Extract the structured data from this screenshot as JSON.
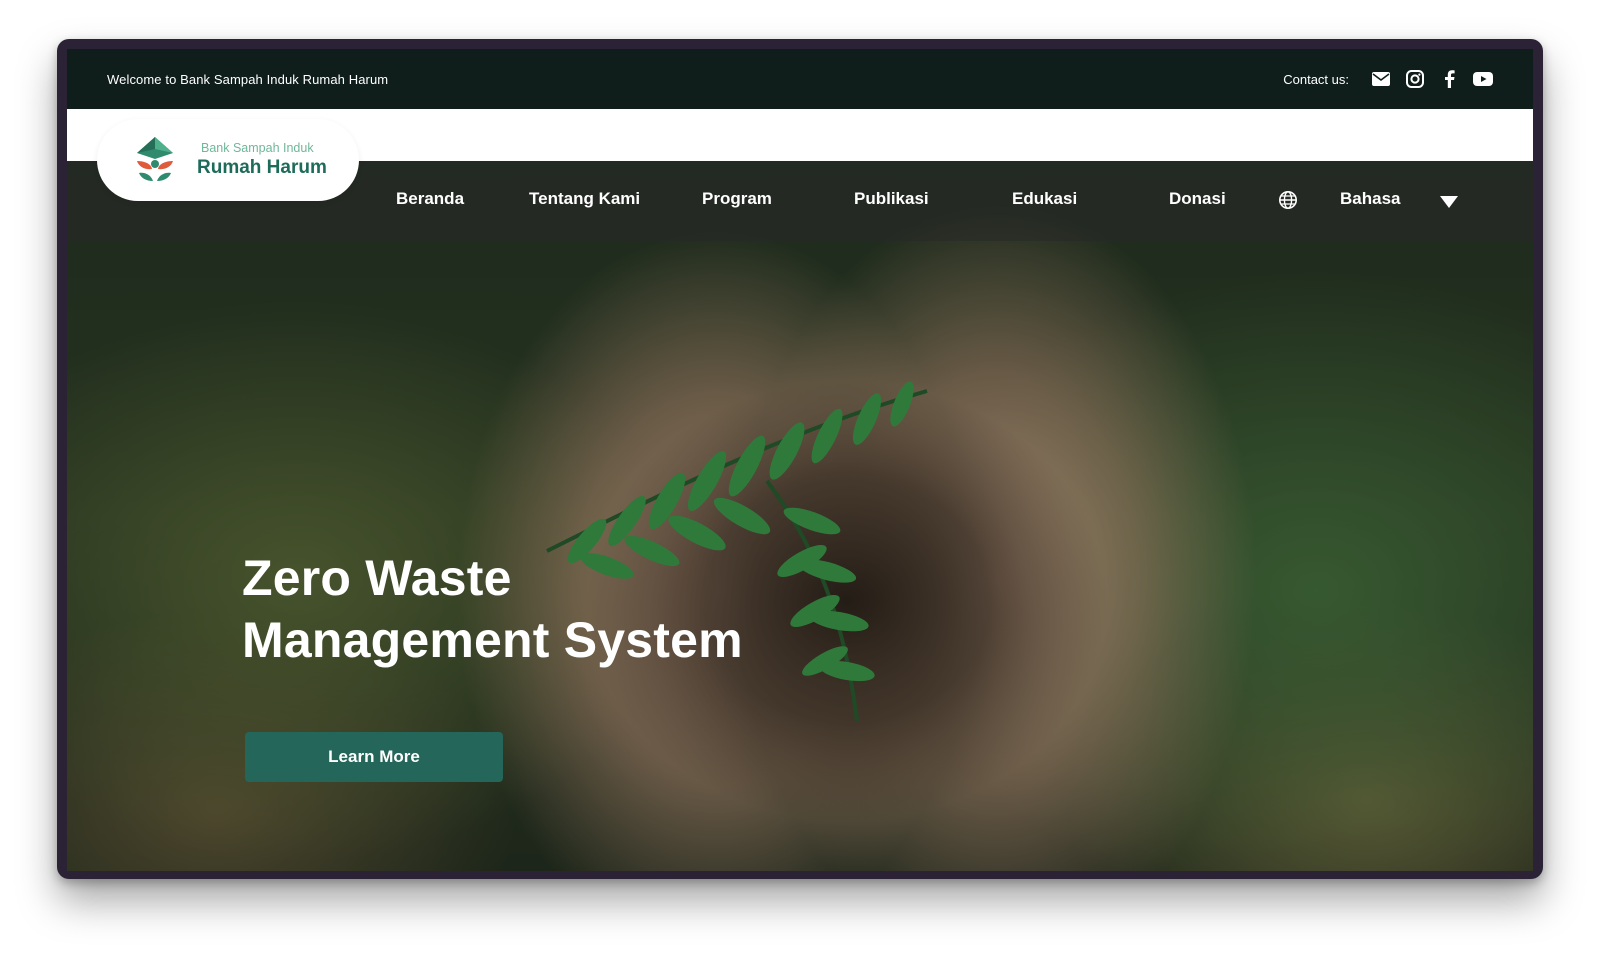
{
  "topbar": {
    "welcome_text": "Welcome to Bank Sampah Induk Rumah Harum",
    "contact_label": "Contact us:",
    "icons": [
      "mail-icon",
      "instagram-icon",
      "facebook-icon",
      "youtube-icon"
    ]
  },
  "logo": {
    "subtitle": "Bank Sampah Induk",
    "title": "Rumah Harum"
  },
  "nav": {
    "items": [
      {
        "label": "Beranda"
      },
      {
        "label": "Tentang Kami"
      },
      {
        "label": "Program"
      },
      {
        "label": "Publikasi"
      },
      {
        "label": "Edukasi"
      },
      {
        "label": "Donasi"
      }
    ],
    "language_label": "Bahasa"
  },
  "hero": {
    "headline_line1": "Zero Waste",
    "headline_line2": "Management System",
    "cta_label": "Learn More"
  },
  "colors": {
    "topbar_bg": "#0f1e1b",
    "brand_green": "#1f6b5a",
    "cta_bg": "#25665a",
    "logo_accent_red": "#e05a3c"
  }
}
